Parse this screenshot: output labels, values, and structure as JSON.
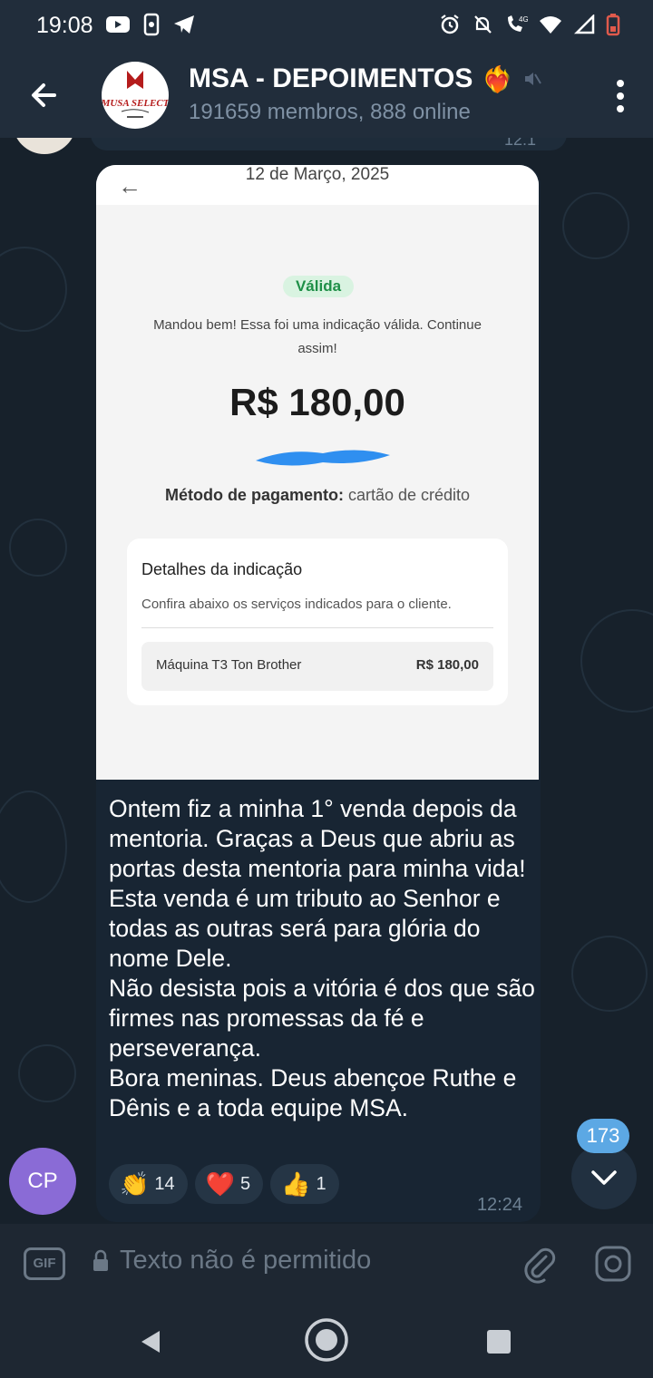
{
  "status_bar": {
    "time": "19:08"
  },
  "header": {
    "title": "MSA - DEPOIMENTOS",
    "emoji": "❤️‍🔥",
    "subtitle": "191659 membros, 888 online",
    "avatar_logo_text": "MUSA SELECT"
  },
  "previous_message": {
    "time": "12:1"
  },
  "message": {
    "screenshot": {
      "date": "12 de Março, 2025",
      "status_badge": "Válida",
      "description": "Mandou bem! Essa foi uma indicação válida. Continue assim!",
      "amount": "R$ 180,00",
      "payment_method_label": "Método de pagamento:",
      "payment_method_value": "cartão de crédito",
      "details_title": "Detalhes da indicação",
      "details_subtitle": "Confira abaixo os serviços indicados para o cliente.",
      "item_name": "Máquina T3 Ton Brother",
      "item_price": "R$ 180,00"
    },
    "text": "Ontem fiz a minha 1° venda depois da mentoria. Graças a Deus que abriu as portas desta mentoria para minha vida!\nEsta venda é um tributo ao Senhor e todas as outras será para glória do nome Dele.\nNão desista pois a vitória é dos que são firmes nas promessas da fé e perseverança.\nBora meninas. Deus abençoe Ruthe e Dênis e a toda equipe MSA.",
    "reactions": [
      {
        "emoji": "👏",
        "count": "14"
      },
      {
        "emoji": "❤️",
        "count": "5"
      },
      {
        "emoji": "👍",
        "count": "1"
      }
    ],
    "time": "12:24",
    "sender_initials": "CP"
  },
  "unread_count": "173",
  "input": {
    "gif_label": "GIF",
    "placeholder": "Texto não é permitido"
  },
  "colors": {
    "accent": "#5ca8e4",
    "header_bg": "#212d3b",
    "chat_bg": "#17212b",
    "bubble_bg": "#182533",
    "valid_green": "#1e8f47",
    "avatar_purple": "#8a6bd6"
  }
}
